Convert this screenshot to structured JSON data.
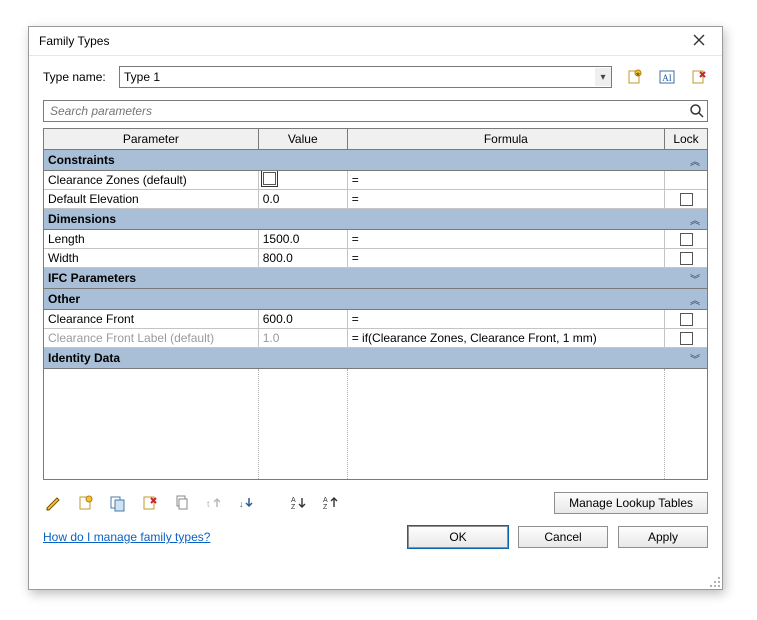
{
  "window": {
    "title": "Family Types"
  },
  "typename": {
    "label": "Type name:",
    "value": "Type 1"
  },
  "search": {
    "placeholder": "Search parameters"
  },
  "headers": {
    "param": "Parameter",
    "value": "Value",
    "formula": "Formula",
    "lock": "Lock"
  },
  "groups": {
    "constraints": "Constraints",
    "dimensions": "Dimensions",
    "ifc": "IFC Parameters",
    "other": "Other",
    "identity": "Identity Data"
  },
  "rows": {
    "czones": {
      "name": "Clearance Zones (default)",
      "value": "",
      "formula": "=",
      "lock": false
    },
    "defelev": {
      "name": "Default Elevation",
      "value": "0.0",
      "formula": "=",
      "lock": false,
      "showLock": true
    },
    "length": {
      "name": "Length",
      "value": "1500.0",
      "formula": "=",
      "lock": false,
      "showLock": true
    },
    "width": {
      "name": "Width",
      "value": "800.0",
      "formula": "=",
      "lock": false,
      "showLock": true
    },
    "cfront": {
      "name": "Clearance Front",
      "value": "600.0",
      "formula": "=",
      "lock": false,
      "showLock": true
    },
    "cflabel": {
      "name": "Clearance Front Label (default)",
      "value": "1.0",
      "formula": "= if(Clearance Zones, Clearance Front, 1 mm)",
      "lock": false,
      "showLock": true,
      "dim": true
    }
  },
  "buttons": {
    "manage": "Manage Lookup Tables",
    "ok": "OK",
    "cancel": "Cancel",
    "apply": "Apply"
  },
  "link": "How do I manage family types?",
  "colors": {
    "groupbg": "#a8bfd7"
  }
}
